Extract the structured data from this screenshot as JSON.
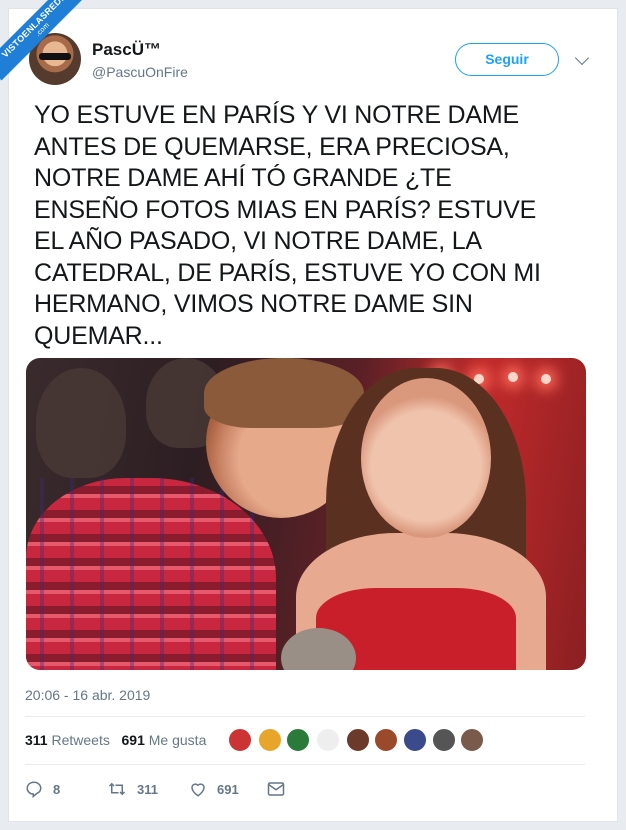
{
  "watermark": {
    "line1": "VISTOENLASREDES",
    "line2": ".com"
  },
  "tweet": {
    "author_name": "PascÜ™",
    "author_handle": "@PascuOnFire",
    "follow_label": "Seguir",
    "text_lines": [
      "YO ESTUVE EN PARÍS Y VI NOTRE DAME",
      "ANTES DE QUEMARSE, ERA PRECIOSA,",
      "NOTRE DAME AHÍ TÓ GRANDE ¿TE",
      "ENSEÑO FOTOS MIAS EN PARÍS? ESTUVE",
      "EL AÑO PASADO, VI NOTRE DAME, LA",
      "CATEDRAL, DE PARÍS, ESTUVE YO CON MI",
      "HERMANO, VIMOS NOTRE DAME SIN",
      "QUEMAR..."
    ],
    "timestamp": "20:06 - 16 abr. 2019",
    "retweets_count": "311",
    "retweets_label": "Retweets",
    "likes_count": "691",
    "likes_label": "Me gusta"
  },
  "actions": {
    "reply_count": "8",
    "retweet_count": "311",
    "like_count": "691"
  },
  "colors": {
    "accent": "#1da1f2",
    "muted": "#657786",
    "text": "#14171a"
  },
  "icons": [
    "reply-icon",
    "retweet-icon",
    "heart-icon",
    "message-icon",
    "chevron-down-icon"
  ]
}
